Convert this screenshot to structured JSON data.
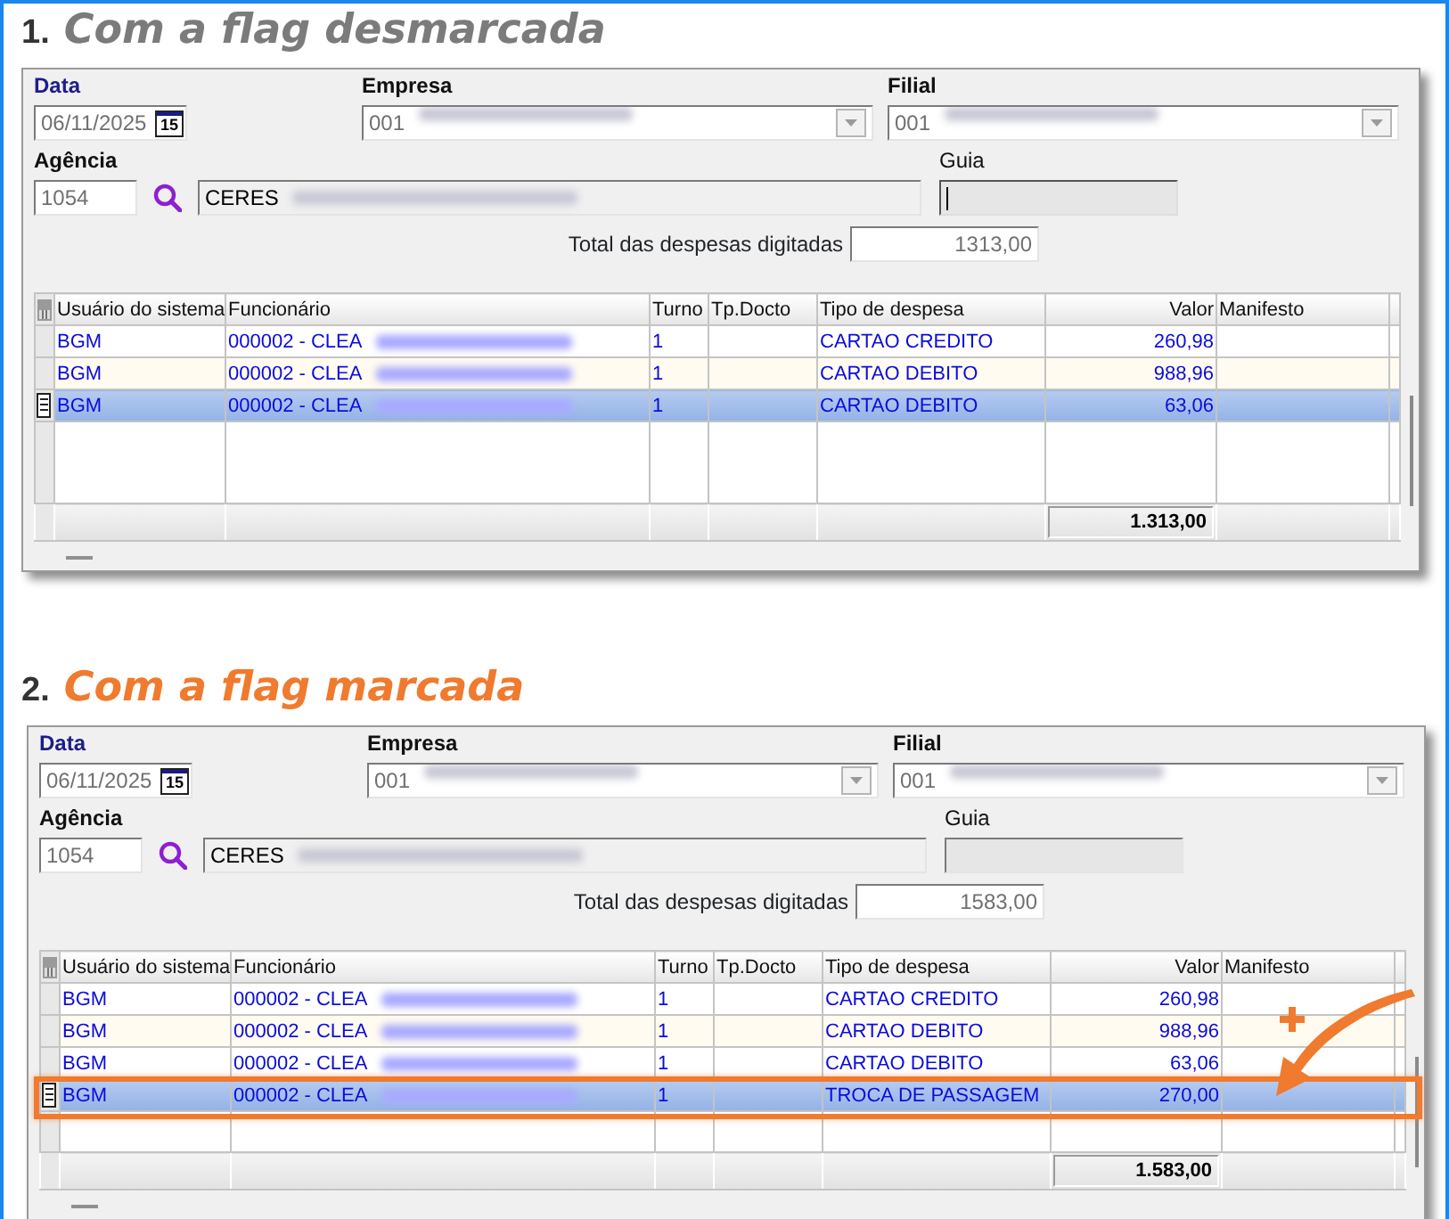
{
  "sections": [
    {
      "number": "1.",
      "title": "Com a flag desmarcada",
      "color": "#7b7b7b",
      "form": {
        "date_label": "Data",
        "date": "06/11/2025",
        "calendar_label": "15",
        "company_label": "Empresa",
        "company": "001",
        "branch_label": "Filial",
        "branch": "001",
        "agency_label": "Agência",
        "agency": "1054",
        "agency_name": "CERES",
        "guide_label": "Guia",
        "guide_focused": true,
        "total_label": "Total das despesas digitadas",
        "total": "1313,00"
      },
      "table": {
        "columns": [
          {
            "label": "Usuário do sistema",
            "kind": "text"
          },
          {
            "label": "Funcionário",
            "kind": "text"
          },
          {
            "label": "Turno",
            "kind": "text"
          },
          {
            "label": "Tp.Docto",
            "kind": "text"
          },
          {
            "label": "Tipo de despesa",
            "kind": "text"
          },
          {
            "label": "Valor",
            "kind": "number"
          },
          {
            "label": "Manifesto",
            "kind": "text"
          }
        ],
        "rows": [
          {
            "cells": [
              "BGM",
              "000002 - CLEA",
              "1",
              "",
              "CARTAO CREDITO",
              "260,98",
              ""
            ],
            "selected": false,
            "highlighted": false
          },
          {
            "cells": [
              "BGM",
              "000002 - CLEA",
              "1",
              "",
              "CARTAO DEBITO",
              "988,96",
              ""
            ],
            "selected": false,
            "highlighted": false
          },
          {
            "cells": [
              "BGM",
              "000002 - CLEA",
              "1",
              "",
              "CARTAO DEBITO",
              "63,06",
              ""
            ],
            "selected": true,
            "highlighted": false
          }
        ],
        "footer_total": "1.313,00"
      }
    },
    {
      "number": "2.",
      "title": "Com a flag marcada",
      "color": "#f07a2e",
      "form": {
        "date_label": "Data",
        "date": "06/11/2025",
        "calendar_label": "15",
        "company_label": "Empresa",
        "company": "001",
        "branch_label": "Filial",
        "branch": "001",
        "agency_label": "Agência",
        "agency": "1054",
        "agency_name": "CERES",
        "guide_label": "Guia",
        "guide_focused": false,
        "total_label": "Total das despesas digitadas",
        "total": "1583,00"
      },
      "table": {
        "columns": [
          {
            "label": "Usuário do sistema",
            "kind": "text"
          },
          {
            "label": "Funcionário",
            "kind": "text"
          },
          {
            "label": "Turno",
            "kind": "text"
          },
          {
            "label": "Tp.Docto",
            "kind": "text"
          },
          {
            "label": "Tipo de despesa",
            "kind": "text"
          },
          {
            "label": "Valor",
            "kind": "number"
          },
          {
            "label": "Manifesto",
            "kind": "text"
          }
        ],
        "rows": [
          {
            "cells": [
              "BGM",
              "000002 - CLEA",
              "1",
              "",
              "CARTAO CREDITO",
              "260,98",
              ""
            ],
            "selected": false,
            "highlighted": false
          },
          {
            "cells": [
              "BGM",
              "000002 - CLEA",
              "1",
              "",
              "CARTAO DEBITO",
              "988,96",
              ""
            ],
            "selected": false,
            "highlighted": false
          },
          {
            "cells": [
              "BGM",
              "000002 - CLEA",
              "1",
              "",
              "CARTAO DEBITO",
              "63,06",
              ""
            ],
            "selected": false,
            "highlighted": false
          },
          {
            "cells": [
              "BGM",
              "000002 - CLEA",
              "1",
              "",
              "TROCA DE PASSAGEM",
              "270,00",
              ""
            ],
            "selected": true,
            "highlighted": true
          }
        ],
        "footer_total": "1.583,00"
      }
    }
  ]
}
